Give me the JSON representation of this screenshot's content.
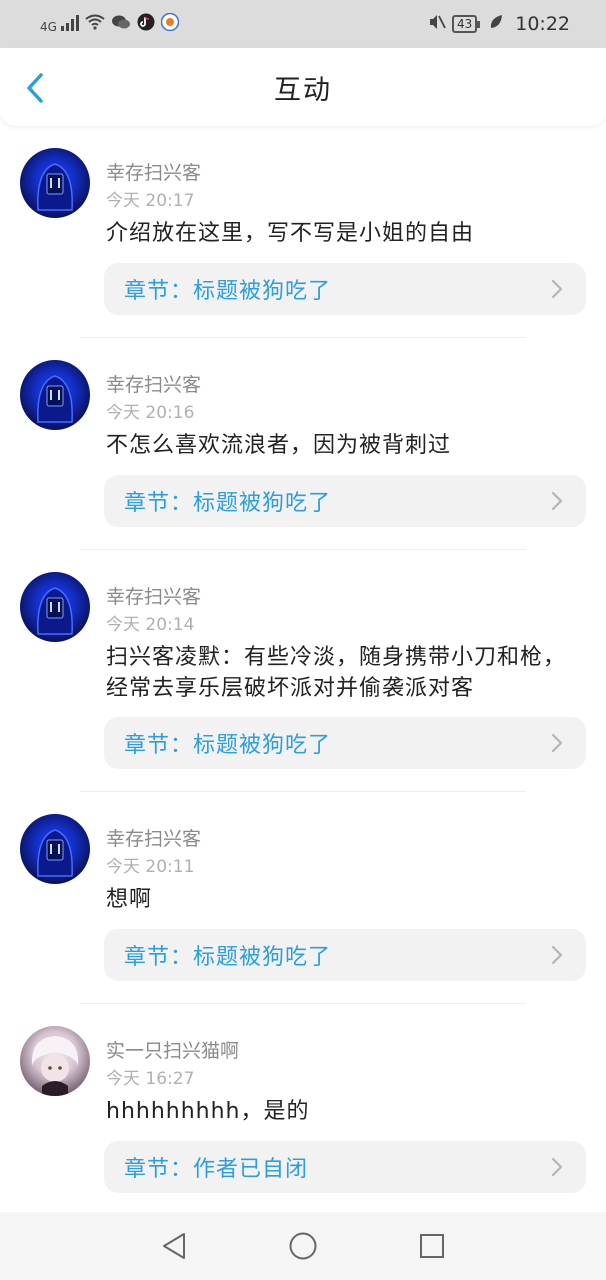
{
  "status_bar": {
    "network": "4G",
    "battery": "43",
    "time": "10:22",
    "icons": [
      "signal-icon",
      "wifi-icon",
      "wechat-icon",
      "tiktok-icon",
      "app-icon",
      "mute-icon",
      "battery-icon",
      "leaf-icon"
    ]
  },
  "header": {
    "title": "互动"
  },
  "comments": [
    {
      "user": "幸存扫兴客",
      "time": "今天 20:17",
      "text": "介绍放在这里，写不写是小姐的自由",
      "chapter": "章节：标题被狗吃了",
      "avatar": "hooded-figure"
    },
    {
      "user": "幸存扫兴客",
      "time": "今天 20:16",
      "text": "不怎么喜欢流浪者，因为被背刺过",
      "chapter": "章节：标题被狗吃了",
      "avatar": "hooded-figure"
    },
    {
      "user": "幸存扫兴客",
      "time": "今天 20:14",
      "text": "扫兴客凌默：有些冷淡，随身携带小刀和枪，经常去享乐层破坏派对并偷袭派对客",
      "chapter": "章节：标题被狗吃了",
      "avatar": "hooded-figure"
    },
    {
      "user": "幸存扫兴客",
      "time": "今天 20:11",
      "text": "想啊",
      "chapter": "章节：标题被狗吃了",
      "avatar": "hooded-figure"
    },
    {
      "user": "实一只扫兴猫啊",
      "time": "今天 16:27",
      "text": "hhhhhhhhh，是的",
      "chapter": "章节：作者已自闭",
      "avatar": "anime-girl"
    }
  ],
  "colors": {
    "accent": "#2a9ee0",
    "status_bar_bg": "#dcdcdc",
    "chapter_bg": "#f2f2f2"
  }
}
